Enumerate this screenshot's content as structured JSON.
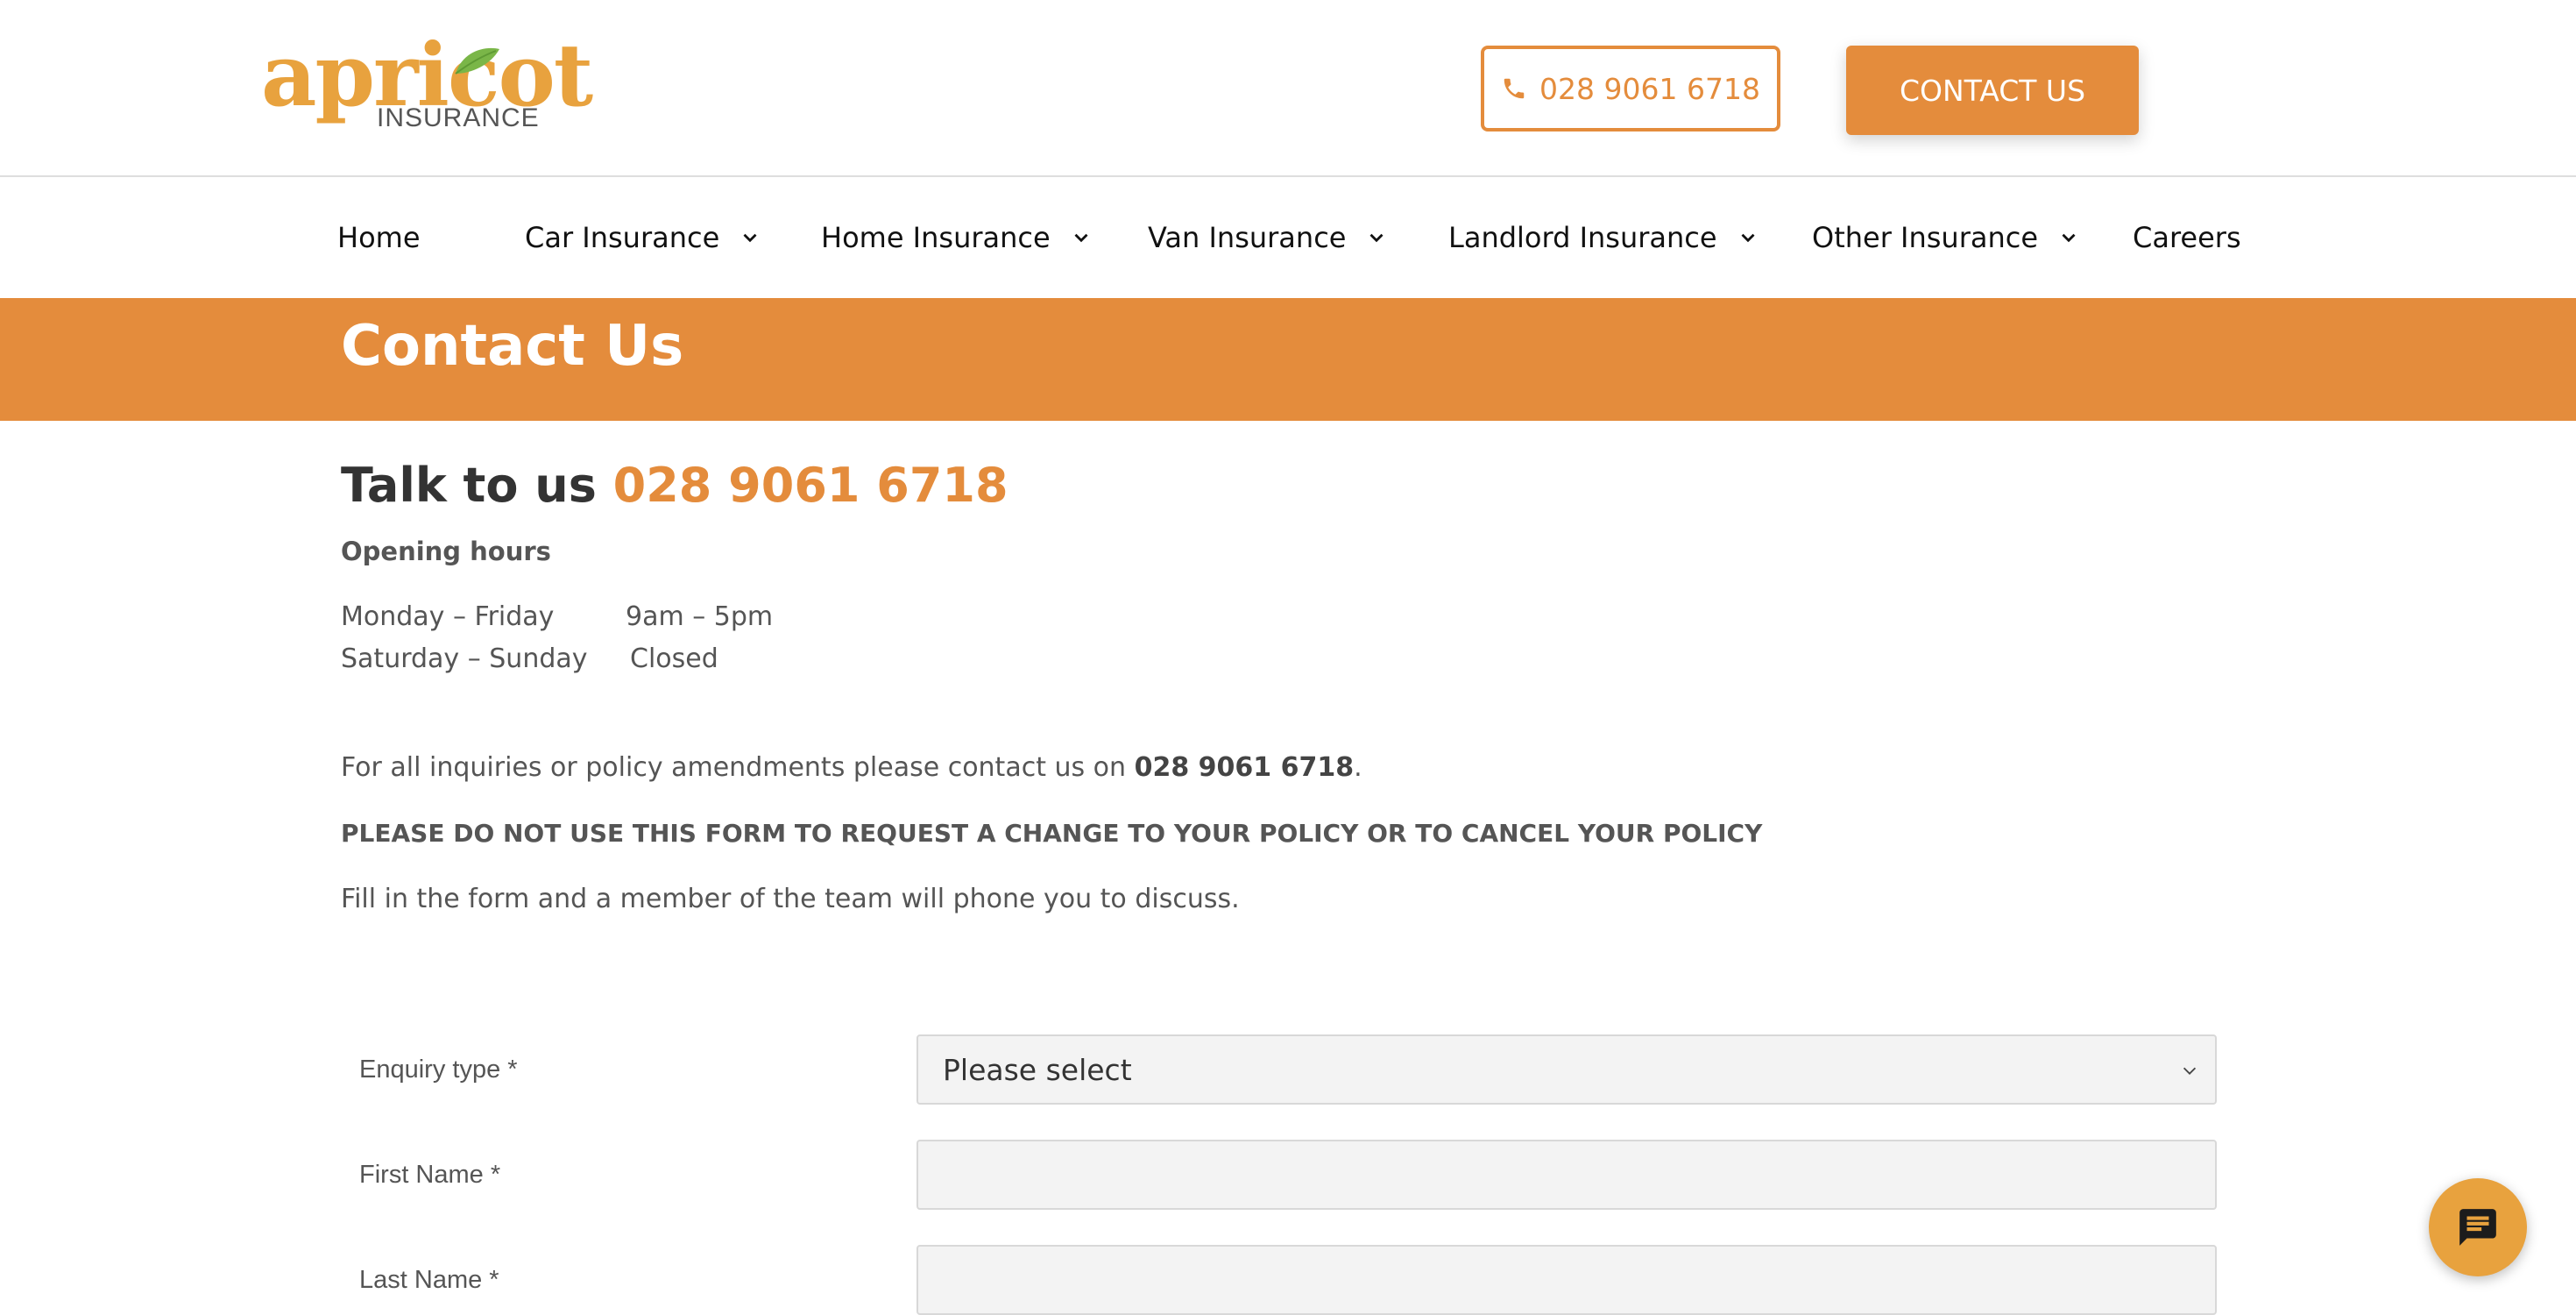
{
  "header": {
    "logo": {
      "word": "apricot",
      "sub": "INSURANCE"
    },
    "phone": "028 9061 6718",
    "contact_button": "CONTACT US"
  },
  "nav": {
    "items": [
      {
        "label": "Home",
        "dropdown": false
      },
      {
        "label": "Car Insurance",
        "dropdown": true
      },
      {
        "label": "Home Insurance",
        "dropdown": true
      },
      {
        "label": "Van Insurance",
        "dropdown": true
      },
      {
        "label": "Landlord Insurance",
        "dropdown": true
      },
      {
        "label": "Other Insurance",
        "dropdown": true
      },
      {
        "label": "Careers",
        "dropdown": false
      }
    ]
  },
  "banner": {
    "title": "Contact Us"
  },
  "content": {
    "talk_prefix": "Talk to us",
    "talk_phone": "028 9061 6718",
    "hours_heading": "Opening hours",
    "hours": [
      {
        "days": "Monday – Friday",
        "time": "9am – 5pm"
      },
      {
        "days": "Saturday – Sunday",
        "time": "Closed"
      }
    ],
    "inquiries_text": "For all inquiries or policy amendments please contact us on ",
    "inquiries_phone": "028 9061 6718",
    "inquiries_end": ".",
    "warning": "PLEASE DO NOT USE THIS FORM TO REQUEST A CHANGE TO YOUR POLICY OR TO CANCEL YOUR POLICY",
    "instruction": "Fill in the form and a member of the team will phone you to discuss."
  },
  "form": {
    "enquiry_label": "Enquiry type",
    "enquiry_value": "Please select",
    "first_name_label": "First Name",
    "first_name_value": "",
    "last_name_label": "Last Name",
    "last_name_value": "",
    "required_mark": "*"
  },
  "colors": {
    "accent": "#e48c3c",
    "logo": "#e8a23e",
    "leaf": "#7ab648"
  },
  "icons": {
    "phone": "phone-icon",
    "chat": "chat-icon",
    "chevron": "chevron-down-icon"
  }
}
